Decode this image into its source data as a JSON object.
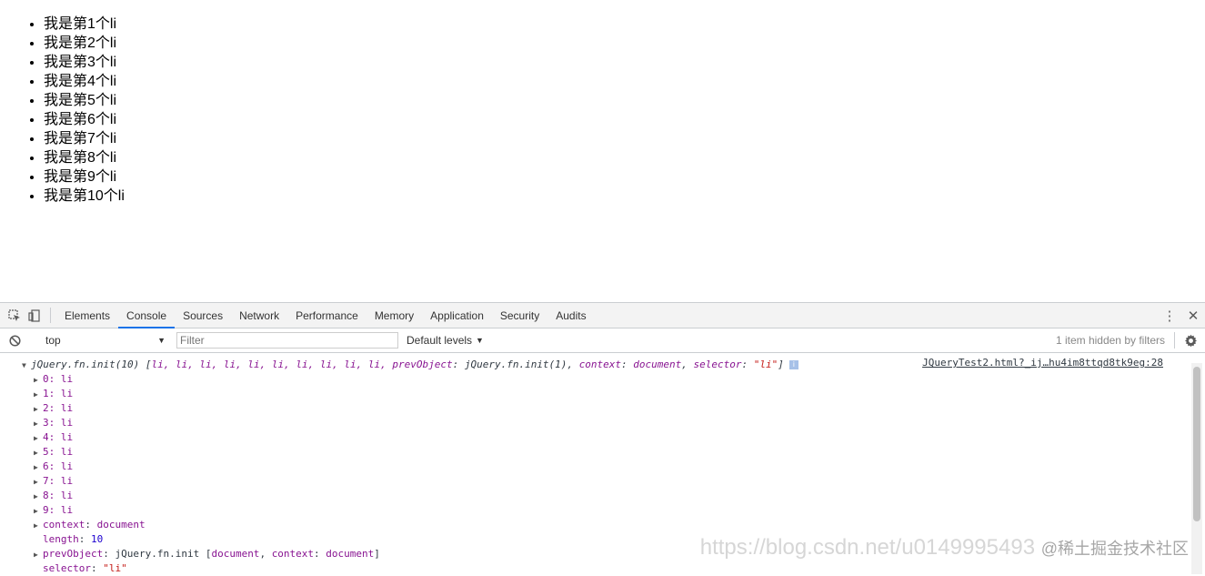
{
  "page": {
    "items": [
      "我是第1个li",
      "我是第2个li",
      "我是第3个li",
      "我是第4个li",
      "我是第5个li",
      "我是第6个li",
      "我是第7个li",
      "我是第8个li",
      "我是第9个li",
      "我是第10个li"
    ]
  },
  "devtools": {
    "tabs": [
      "Elements",
      "Console",
      "Sources",
      "Network",
      "Performance",
      "Memory",
      "Application",
      "Security",
      "Audits"
    ],
    "active_tab": "Console",
    "toolbar": {
      "context": "top",
      "filter_placeholder": "Filter",
      "levels": "Default levels",
      "hidden": "1 item hidden by filters"
    },
    "console": {
      "source": "JQueryTest2.html?_ij…hu4im8ttqd8tk9eg:28",
      "summary_prefix": "jQuery.fn.init(10) [",
      "summary_items": "li, li, li, li, li, li, li, li, li, li, ",
      "summary_prev_key": "prevObject",
      "summary_prev_val": "jQuery.fn.init(1)",
      "summary_ctx_key": "context",
      "summary_ctx_val": "document",
      "summary_sel_key": "selector",
      "summary_sel_val": "\"li\"",
      "summary_close": "]",
      "info_badge": "i",
      "entries": [
        {
          "key": "0",
          "val": "li"
        },
        {
          "key": "1",
          "val": "li"
        },
        {
          "key": "2",
          "val": "li"
        },
        {
          "key": "3",
          "val": "li"
        },
        {
          "key": "4",
          "val": "li"
        },
        {
          "key": "5",
          "val": "li"
        },
        {
          "key": "6",
          "val": "li"
        },
        {
          "key": "7",
          "val": "li"
        },
        {
          "key": "8",
          "val": "li"
        },
        {
          "key": "9",
          "val": "li"
        }
      ],
      "context_key": "context",
      "context_val": "document",
      "length_key": "length",
      "length_val": "10",
      "prev_key": "prevObject",
      "prev_val": "jQuery.fn.init [",
      "prev_doc": "document",
      "prev_ctx_key": "context",
      "prev_ctx_val": "document",
      "prev_close": "]",
      "selector_key": "selector",
      "selector_val": "\"li\""
    }
  },
  "watermark": {
    "url": "https://blog.csdn.net/u0149995493",
    "brand": "@稀土掘金技术社区"
  },
  "colors": {
    "active_tab_underline": "#1a73e8",
    "key_purple": "#881391",
    "number_blue": "#1c00cf",
    "string_red": "#c41a16"
  }
}
